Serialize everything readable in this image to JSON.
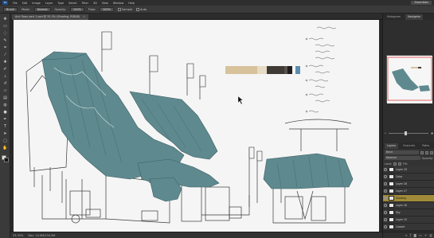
{
  "menubar": {
    "logo": "Ps",
    "items": [
      "File",
      "Edit",
      "Image",
      "Layer",
      "Type",
      "Select",
      "Filter",
      "3D",
      "View",
      "Window",
      "Help"
    ],
    "workspace": "Essentials"
  },
  "options": {
    "brush_preset": "Brush",
    "mode_label": "Mode:",
    "mode": "Normal",
    "opacity_label": "Opacity:",
    "opacity": "100%",
    "flow_label": "Flow:",
    "flow": "100%",
    "checkbox_a": "Sample",
    "checkbox_b": "Auto"
  },
  "document": {
    "tab_title": "Anh Town part 1.psd @ 33.3% (Shading, RGB/8)",
    "tab_close": "×",
    "zoom": "33.33%",
    "doc_info": "Doc: 14.9M/134.5M"
  },
  "palette": {
    "colors": [
      "#d7c29b",
      "#e6dbc4",
      "#3f3a36",
      "#58514b",
      "#1e1e1e",
      "#5b8fb2"
    ]
  },
  "panels": {
    "top_tabs": [
      "Histogram",
      "Navigator"
    ],
    "layers_tabs": [
      "Layers",
      "Channels",
      "Paths"
    ],
    "kind_label": "Kind",
    "blend_mode": "Normal",
    "opacity_label": "Opacity:",
    "fill_label": "Fill:",
    "lock_label": "Lock:",
    "layers": [
      {
        "name": "Layer 19",
        "highlighted": false
      },
      {
        "name": "Color",
        "highlighted": false
      },
      {
        "name": "Layer 18",
        "highlighted": false
      },
      {
        "name": "Layer 17",
        "highlighted": false
      },
      {
        "name": "Shading",
        "highlighted": true
      },
      {
        "name": "Layer 16",
        "highlighted": false
      },
      {
        "name": "Sky",
        "highlighted": false
      },
      {
        "name": "Layer 15",
        "highlighted": false
      },
      {
        "name": "Lineart",
        "highlighted": false
      }
    ],
    "footer_icons": [
      "link-icon",
      "fx-icon",
      "mask-icon",
      "folder-icon",
      "new-layer-icon",
      "trash-icon"
    ]
  },
  "colors": {
    "roof_teal": "#5e8a8f",
    "sketch_line": "#3a3a3a",
    "paper": "#f5f5f5",
    "highlight": "#a08a3a"
  }
}
